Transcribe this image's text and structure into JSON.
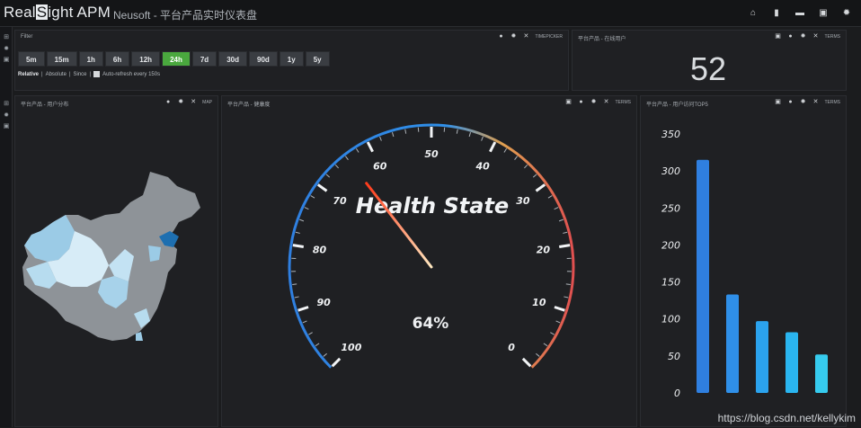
{
  "app": {
    "logo_pre": "Real",
    "logo_box": "S",
    "logo_post": "ight APM",
    "subtitle": "Neusoft - 平台产品实时仪表盘"
  },
  "topbar_icons": [
    "home-icon",
    "file-icon",
    "folder-icon",
    "save-icon",
    "gear-icon"
  ],
  "panel_time": {
    "title": "Filter",
    "ctrl_label": "TIMEPICKER",
    "buttons": [
      "5m",
      "15m",
      "1h",
      "6h",
      "12h",
      "24h",
      "7d",
      "30d",
      "90d",
      "1y",
      "5y"
    ],
    "active_button": "24h",
    "mode_relative": "Relative",
    "mode_absolute": "Absolute",
    "mode_since": "Since",
    "auto_refresh": "Auto-refresh every 150s"
  },
  "panel_count": {
    "title": "平台产品 - 在线用户",
    "ctrl_label": "TERMS",
    "value": "52"
  },
  "panel_map": {
    "title": "平台产品 - 用户分布",
    "ctrl_label": "MAP"
  },
  "panel_gauge": {
    "title": "平台产品 - 健康度",
    "ctrl_label": "TERMS",
    "heading": "Health State",
    "percent_label": "64%",
    "ticks": [
      "100",
      "90",
      "80",
      "70",
      "60",
      "50",
      "40",
      "30",
      "20",
      "10",
      "0"
    ],
    "value": 64
  },
  "panel_bars": {
    "title": "平台产品 - 用户访问TOP5",
    "ctrl_label": "TERMS"
  },
  "chart_data": {
    "type": "bar",
    "categories": [
      "",
      "",
      "",
      "",
      ""
    ],
    "values": [
      315,
      133,
      97,
      82,
      52
    ],
    "ylim": [
      0,
      350
    ],
    "yticks": [
      "0",
      "50",
      "100",
      "150",
      "200",
      "250",
      "300",
      "350"
    ],
    "colors": [
      "#2f7fe0",
      "#2f8fe8",
      "#2ba3ee",
      "#2ab5f0",
      "#36cbee"
    ]
  },
  "watermark": "https://blog.csdn.net/kellykim"
}
